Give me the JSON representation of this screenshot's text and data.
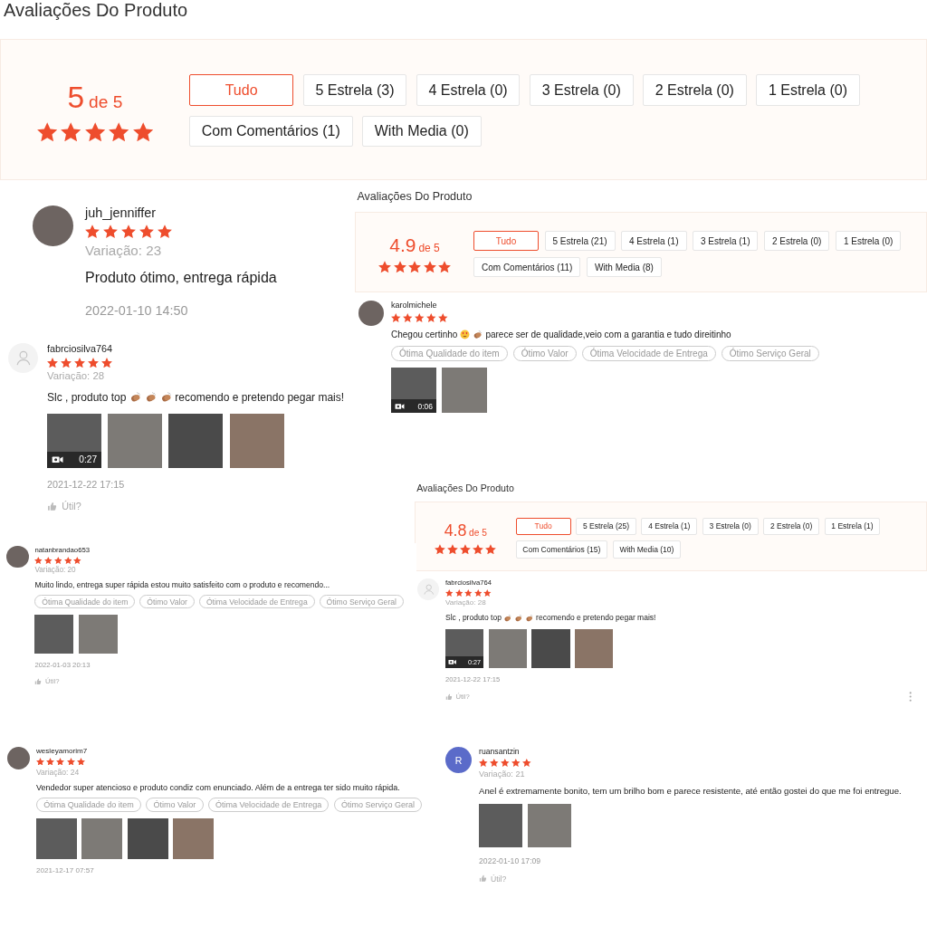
{
  "panels": [
    {
      "title": "Avaliações Do Produto",
      "summary": {
        "score": "5",
        "out_of": "de 5",
        "stars": 5,
        "filters": [
          {
            "label": "Tudo",
            "selected": true
          },
          {
            "label": "5 Estrela (3)",
            "selected": false
          },
          {
            "label": "4 Estrela (0)",
            "selected": false
          },
          {
            "label": "3 Estrela (0)",
            "selected": false
          },
          {
            "label": "2 Estrela (0)",
            "selected": false
          },
          {
            "label": "1 Estrela (0)",
            "selected": false
          },
          {
            "label": "Com Comentários (1)",
            "selected": false
          },
          {
            "label": "With Media (0)",
            "selected": false
          }
        ]
      }
    },
    {
      "reviews": [
        {
          "avatar": {
            "kind": "photo"
          },
          "username": "juh_jenniffer",
          "stars": 5,
          "variation": "Variação: 23",
          "comment": [
            {
              "kind": "text",
              "text": "Produto ótimo, entrega rápida"
            }
          ],
          "date": "2022-01-10 14:50"
        }
      ]
    },
    {
      "title": "Avaliações Do Produto",
      "summary": {
        "score": "4.9",
        "out_of": "de 5",
        "stars": 5,
        "filters": [
          {
            "label": "Tudo",
            "selected": true
          },
          {
            "label": "5 Estrela (21)",
            "selected": false
          },
          {
            "label": "4 Estrela (1)",
            "selected": false
          },
          {
            "label": "3 Estrela (1)",
            "selected": false
          },
          {
            "label": "2 Estrela (0)",
            "selected": false
          },
          {
            "label": "1 Estrela (0)",
            "selected": false
          },
          {
            "label": "Com Comentários (11)",
            "selected": false
          },
          {
            "label": "With Media (8)",
            "selected": false
          }
        ]
      },
      "reviews": [
        {
          "avatar": {
            "kind": "photo"
          },
          "username": "karolmichele",
          "stars": 5,
          "comment": [
            {
              "kind": "text",
              "text": "Chegou certinho"
            },
            {
              "kind": "heart_eyes"
            },
            {
              "kind": "clap"
            },
            {
              "kind": "text",
              "text": "parece ser de qualidade,veio com a garantia e tudo direitinho"
            }
          ],
          "tags": [
            "Ótima Qualidade do item",
            "Ótimo Valor",
            "Ótima Velocidade de Entrega",
            "Ótimo Serviço Geral"
          ],
          "media": [
            {
              "kind": "video",
              "duration": "0:06"
            },
            {
              "kind": "photo"
            }
          ]
        }
      ]
    },
    {
      "reviews": [
        {
          "avatar": {
            "kind": "placeholder"
          },
          "username": "fabrciosilva764",
          "stars": 5,
          "variation": "Variação: 28",
          "comment": [
            {
              "kind": "text",
              "text": "Slc , produto top"
            },
            {
              "kind": "clap"
            },
            {
              "kind": "clap"
            },
            {
              "kind": "clap"
            },
            {
              "kind": "text",
              "text": "recomendo e pretendo pegar mais!"
            }
          ],
          "media": [
            {
              "kind": "video",
              "duration": "0:27"
            },
            {
              "kind": "photo"
            },
            {
              "kind": "photo"
            },
            {
              "kind": "photo"
            }
          ],
          "date": "2021-12-22 17:15",
          "helpful": "Útil?"
        }
      ]
    },
    {
      "title": "Avaliações Do Produto",
      "summary": {
        "score": "4.8",
        "out_of": "de 5",
        "stars": 5,
        "filters": [
          {
            "label": "Tudo",
            "selected": true
          },
          {
            "label": "5 Estrela (25)",
            "selected": false
          },
          {
            "label": "4 Estrela (1)",
            "selected": false
          },
          {
            "label": "3 Estrela (0)",
            "selected": false
          },
          {
            "label": "2 Estrela (0)",
            "selected": false
          },
          {
            "label": "1 Estrela (1)",
            "selected": false
          },
          {
            "label": "Com Comentários (15)",
            "selected": false
          },
          {
            "label": "With Media (10)",
            "selected": false
          }
        ]
      },
      "reviews": [
        {
          "avatar": {
            "kind": "placeholder"
          },
          "username": "fabrciosilva764",
          "stars": 5,
          "variation": "Variação: 28",
          "comment": [
            {
              "kind": "text",
              "text": "Slc , produto top"
            },
            {
              "kind": "clap"
            },
            {
              "kind": "clap"
            },
            {
              "kind": "clap"
            },
            {
              "kind": "text",
              "text": "recomendo e pretendo pegar mais!"
            }
          ],
          "media": [
            {
              "kind": "video",
              "duration": "0:27"
            },
            {
              "kind": "photo"
            },
            {
              "kind": "photo"
            },
            {
              "kind": "photo"
            }
          ],
          "date": "2021-12-22 17:15",
          "helpful": "Útil?",
          "more_menu": true
        }
      ]
    },
    {
      "reviews": [
        {
          "avatar": {
            "kind": "photo"
          },
          "username": "natanbrandao653",
          "stars": 5,
          "variation": "Variação: 20",
          "comment": [
            {
              "kind": "text",
              "text": "Muito lindo, entrega super rápida estou muito satisfeito com o produto e recomendo..."
            }
          ],
          "tags": [
            "Ótima Qualidade do item",
            "Ótimo Valor",
            "Ótima Velocidade de Entrega",
            "Ótimo Serviço Geral"
          ],
          "media": [
            {
              "kind": "photo"
            },
            {
              "kind": "photo"
            }
          ],
          "date": "2022-01-03 20:13",
          "helpful": "Útil?"
        }
      ]
    },
    {
      "reviews": [
        {
          "avatar": {
            "kind": "photo"
          },
          "username": "wesleyamorim7",
          "stars": 5,
          "variation": "Variação: 24",
          "comment": [
            {
              "kind": "text",
              "text": "Vendedor super atencioso e produto condiz com enunciado. Além de a entrega ter sido muito rápida."
            }
          ],
          "tags": [
            "Ótima Qualidade do item",
            "Ótimo Valor",
            "Ótima Velocidade de Entrega",
            "Ótimo Serviço Geral"
          ],
          "media": [
            {
              "kind": "photo"
            },
            {
              "kind": "photo"
            },
            {
              "kind": "photo"
            },
            {
              "kind": "photo"
            }
          ],
          "date": "2021-12-17 07:57"
        }
      ]
    },
    {
      "reviews": [
        {
          "avatar": {
            "kind": "letter",
            "letter": "R",
            "color": "#5b6bc9"
          },
          "username": "ruansantzin",
          "stars": 5,
          "variation": "Variação: 21",
          "comment": [
            {
              "kind": "text",
              "text": "Anel é extremamente bonito, tem um brilho bom e parece resistente, até então gostei do que me foi entregue."
            }
          ],
          "media": [
            {
              "kind": "photo"
            },
            {
              "kind": "photo"
            }
          ],
          "date": "2022-01-10 17:09",
          "helpful": "Útil?"
        }
      ]
    }
  ]
}
